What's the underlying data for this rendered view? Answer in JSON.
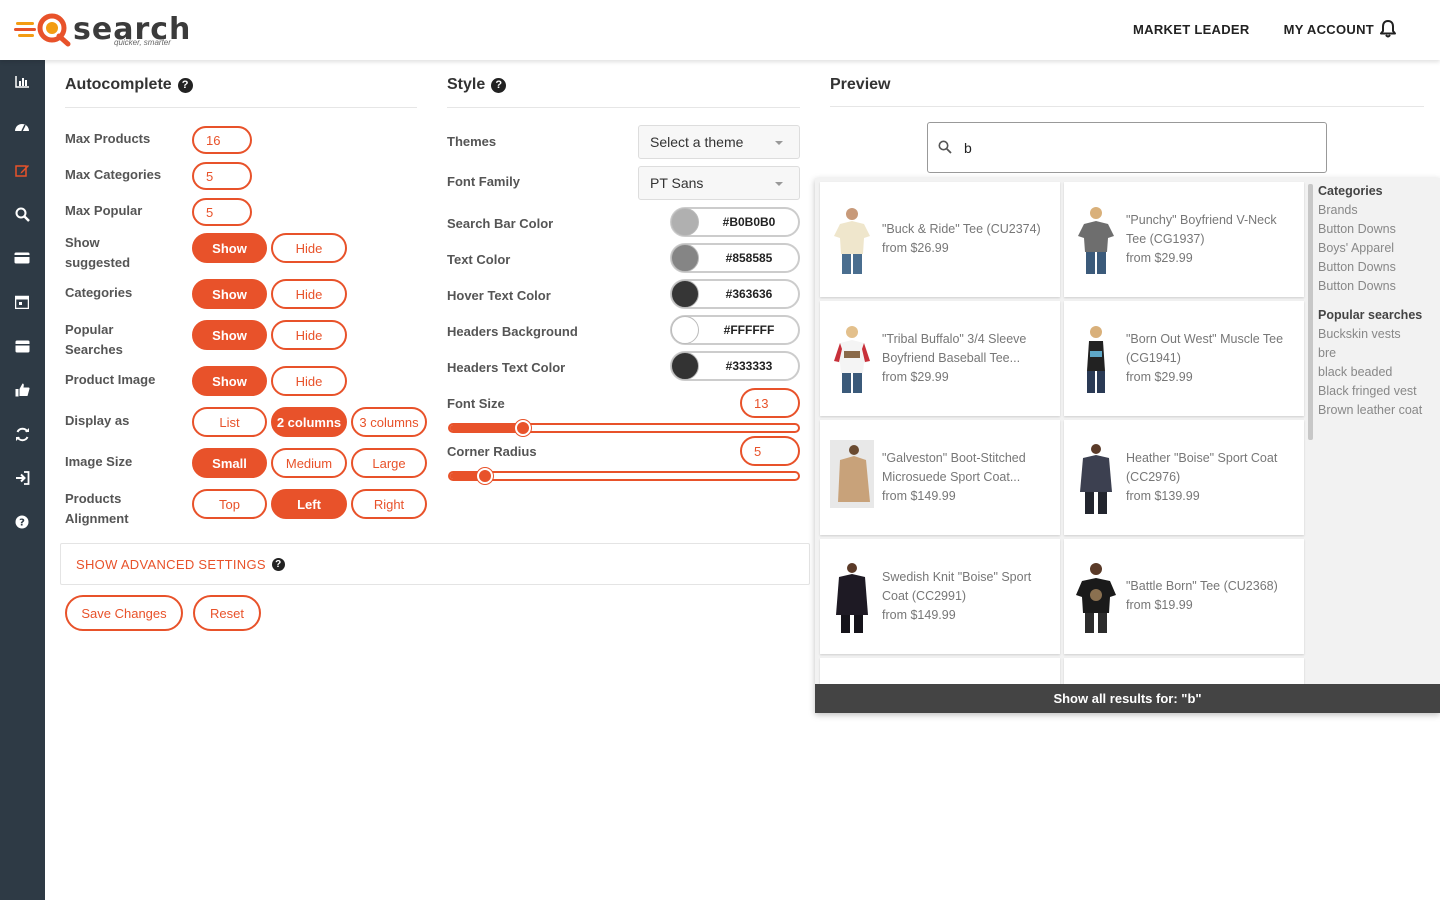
{
  "header": {
    "logo_word": "search",
    "logo_tagline": "quicker, smarter",
    "nav": [
      "MARKET LEADER",
      "MY ACCOUNT"
    ]
  },
  "sidebar": {
    "icons": [
      "bar-chart-icon",
      "dashboard-icon",
      "edit-icon",
      "search-zoom-icon",
      "card-icon",
      "calendar-icon",
      "box-icon",
      "thumbs-up-icon",
      "refresh-icon",
      "sign-in-icon",
      "help-icon"
    ],
    "active_index": 2
  },
  "autocomplete": {
    "title": "Autocomplete",
    "max_products_label": "Max Products",
    "max_products": "16",
    "max_categories_label": "Max Categories",
    "max_categories": "5",
    "max_popular_label": "Max Popular",
    "max_popular": "5",
    "show_suggested_label_1": "Show",
    "show_suggested_label_2": "suggested",
    "categories_label": "Categories",
    "popular_searches_label_1": "Popular",
    "popular_searches_label_2": "Searches",
    "product_image_label": "Product Image",
    "display_as_label": "Display as",
    "image_size_label": "Image Size",
    "products_alignment_label_1": "Products",
    "products_alignment_label_2": "Alignment",
    "show": "Show",
    "hide": "Hide",
    "display_list": "List",
    "display_2col": "2 columns",
    "display_3col": "3 columns",
    "size_small": "Small",
    "size_medium": "Medium",
    "size_large": "Large",
    "align_top": "Top",
    "align_left": "Left",
    "align_right": "Right",
    "advanced": "SHOW ADVANCED SETTINGS",
    "save": "Save Changes",
    "reset": "Reset"
  },
  "style": {
    "title": "Style",
    "themes_label": "Themes",
    "themes_value": "Select a theme",
    "font_family_label": "Font Family",
    "font_family_value": "PT Sans",
    "search_bar_color_label": "Search Bar Color",
    "search_bar_color": "#B0B0B0",
    "text_color_label": "Text Color",
    "text_color": "#858585",
    "hover_text_color_label": "Hover Text Color",
    "hover_text_color": "#363636",
    "headers_bg_label": "Headers Background",
    "headers_bg": "#FFFFFF",
    "headers_text_color_label": "Headers Text Color",
    "headers_text_color": "#333333",
    "font_size_label": "Font Size",
    "font_size": "13",
    "font_size_fraction": 0.21,
    "corner_radius_label": "Corner Radius",
    "corner_radius": "5",
    "corner_radius_fraction": 0.1,
    "accent": "#e8522a"
  },
  "preview": {
    "title": "Preview",
    "query": "b",
    "products": [
      {
        "name": "\"Buck & Ride\" Tee (CU2374)",
        "price": "from $26.99"
      },
      {
        "name": "\"Punchy\" Boyfriend V-Neck Tee (CG1937)",
        "price": "from $29.99"
      },
      {
        "name": "\"Tribal Buffalo\" 3/4 Sleeve Boyfriend Baseball Tee...",
        "price": "from $29.99"
      },
      {
        "name": "\"Born Out West\" Muscle Tee (CG1941)",
        "price": "from $29.99"
      },
      {
        "name": "\"Galveston\" Boot-Stitched Microsuede Sport Coat...",
        "price": "from $149.99"
      },
      {
        "name": "Heather \"Boise\" Sport Coat (CC2976)",
        "price": "from $139.99"
      },
      {
        "name": "Swedish Knit \"Boise\" Sport Coat (CC2991)",
        "price": "from $149.99"
      },
      {
        "name": "\"Battle Born\" Tee (CU2368)",
        "price": "from $19.99"
      }
    ],
    "categories_heading": "Categories",
    "categories": [
      "Brands",
      "Button Downs",
      "Boys' Apparel",
      "Button Downs",
      "Button Downs"
    ],
    "popular_heading": "Popular searches",
    "popular": [
      "Buckskin vests",
      "bre",
      "black beaded",
      "Black fringed vest",
      "Brown leather coat"
    ],
    "show_all": "Show all results for: \"b\""
  }
}
